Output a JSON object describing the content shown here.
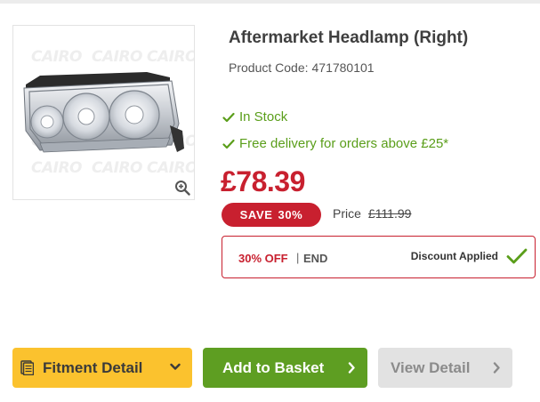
{
  "product": {
    "title": "Aftermarket Headlamp (Right)",
    "code_label": "Product Code:",
    "code_value": "471780101",
    "image_watermark": "CAIRO"
  },
  "features": [
    {
      "icon": "check-icon",
      "text": "In Stock"
    },
    {
      "icon": "check-icon",
      "text": "Free delivery for orders above £25*"
    }
  ],
  "pricing": {
    "price": "£78.39",
    "save_label": "SAVE",
    "save_percent": "30%",
    "was_label": "Price",
    "was_price": "£111.99"
  },
  "discount": {
    "off_text": "30% OFF",
    "separator": "|",
    "end_text": "END",
    "applied_text": "Discount Applied"
  },
  "buttons": {
    "fitment": "Fitment Detail",
    "basket": "Add to Basket",
    "view": "View Detail"
  },
  "colors": {
    "accent_red": "#c8202f",
    "stock_green": "#5a9e1a",
    "basket_green": "#5e9e22",
    "fitment_yellow": "#fbc22e",
    "disabled_gray": "#e2e2e2"
  }
}
